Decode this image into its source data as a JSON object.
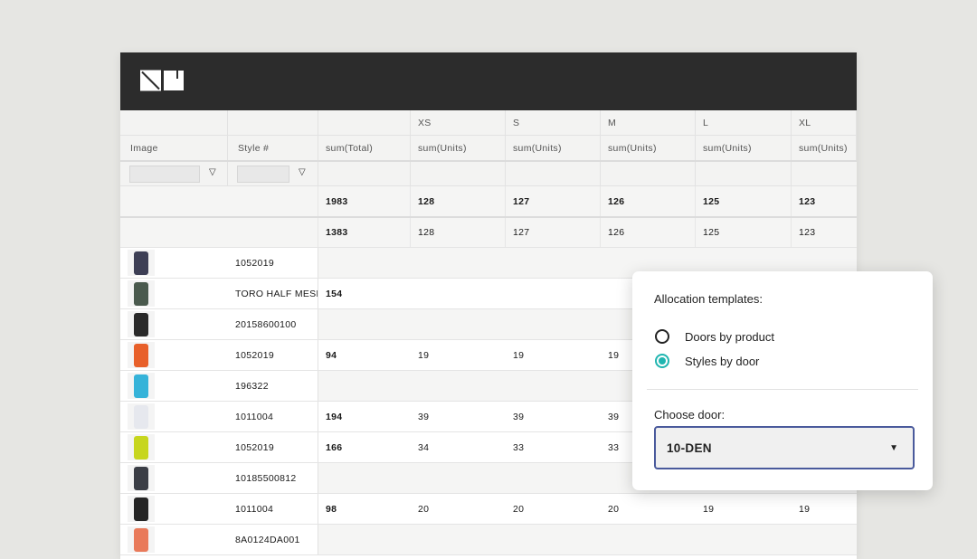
{
  "columns": {
    "image": "Image",
    "style": "Style #",
    "total_sub": "sum(Total)",
    "sizes": [
      "XS",
      "S",
      "M",
      "L",
      "XL"
    ],
    "units_sub": "sum(Units)"
  },
  "filter_icon": "funnel-icon",
  "totals": {
    "grand": "1983",
    "sizes": [
      "128",
      "127",
      "126",
      "125",
      "123"
    ]
  },
  "subtotals": {
    "grand": "1383",
    "sizes": [
      "128",
      "127",
      "126",
      "125",
      "123"
    ]
  },
  "rows": [
    {
      "style": "1052019",
      "total": "",
      "sizes": [
        "",
        "",
        "",
        "",
        ""
      ],
      "thumb_color": "#3d3f55"
    },
    {
      "style": "TORO HALF MESH",
      "total": "154",
      "sizes": [
        "",
        "",
        "",
        "",
        ""
      ],
      "thumb_color": "#4a5a4e"
    },
    {
      "style": "20158600100",
      "total": "",
      "sizes": [
        "",
        "",
        "",
        "",
        ""
      ],
      "thumb_color": "#2a2a2a"
    },
    {
      "style": "1052019",
      "total": "94",
      "sizes": [
        "19",
        "19",
        "19",
        "",
        ""
      ],
      "thumb_color": "#e8602a"
    },
    {
      "style": "196322",
      "total": "",
      "sizes": [
        "",
        "",
        "",
        "",
        ""
      ],
      "thumb_color": "#36b3d9"
    },
    {
      "style": "1011004",
      "total": "194",
      "sizes": [
        "39",
        "39",
        "39",
        "",
        ""
      ],
      "thumb_color": "#e6e8ee"
    },
    {
      "style": "1052019",
      "total": "166",
      "sizes": [
        "34",
        "33",
        "33",
        "",
        ""
      ],
      "thumb_color": "#c7d61e"
    },
    {
      "style": "10185500812",
      "total": "",
      "sizes": [
        "",
        "",
        "",
        "",
        ""
      ],
      "thumb_color": "#3b3e46"
    },
    {
      "style": "1011004",
      "total": "98",
      "sizes": [
        "20",
        "20",
        "20",
        "19",
        "19"
      ],
      "thumb_color": "#252525"
    },
    {
      "style": "8A0124DA001",
      "total": "",
      "sizes": [
        "",
        "",
        "",
        "",
        ""
      ],
      "thumb_color": "#e97a5a"
    }
  ],
  "popup": {
    "title": "Allocation templates:",
    "options": [
      {
        "label": "Doors by product",
        "selected": false
      },
      {
        "label": "Styles by door",
        "selected": true
      }
    ],
    "door_label": "Choose door:",
    "door_value": "10-DEN"
  },
  "colors": {
    "topbar": "#2c2c2c",
    "accent_radio": "#1fb5b0",
    "select_border": "#4a5a9c"
  }
}
